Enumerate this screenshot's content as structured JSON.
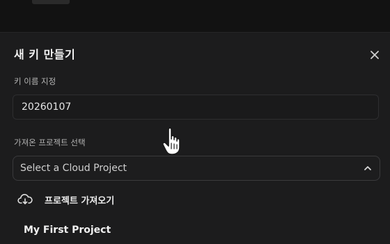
{
  "dialog": {
    "title": "새 키 만들기",
    "close_icon": "close-icon"
  },
  "key_name": {
    "label": "키 이름 지정",
    "value": "20260107"
  },
  "project_select": {
    "label": "가져온 프로젝트 선택",
    "placeholder": "Select a Cloud Project",
    "state": "expanded",
    "chevron_icon": "chevron-up-icon"
  },
  "dropdown": {
    "import_item": {
      "icon": "cloud-download-icon",
      "label": "프로젝트 가져오기"
    },
    "projects": [
      {
        "label": "My First Project"
      }
    ]
  },
  "cursor": {
    "icon": "hand-pointer-icon"
  }
}
